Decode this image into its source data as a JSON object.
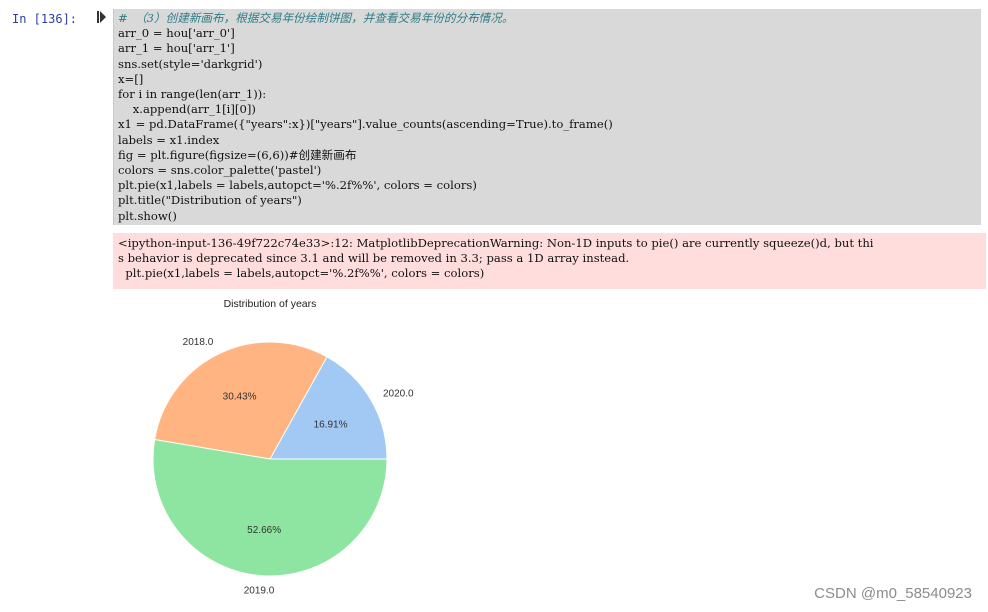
{
  "cell": {
    "prompt": "In  [136]:",
    "code_lines": [
      "#  （3）创建新画布，根据交易年份绘制饼图，并查看交易年份的分布情况。",
      "arr_0 = hou['arr_0']",
      "arr_1 = hou['arr_1']",
      "sns.set(style='darkgrid')",
      "x=[]",
      "for i in range(len(arr_1)):",
      "    x.append(arr_1[i][0])",
      "x1 = pd.DataFrame({\"years\":x})[\"years\"].value_counts(ascending=True).to_frame()",
      "labels = x1.index",
      "fig = plt.figure(figsize=(6,6))#创建新画布",
      "colors = sns.color_palette('pastel')",
      "plt.pie(x1,labels = labels,autopct='%.2f%%', colors = colors)",
      "plt.title(\"Distribution of years\")",
      "plt.show()"
    ],
    "warning_lines": [
      "<ipython-input-136-49f722c74e33>:12: MatplotlibDeprecationWarning: Non-1D inputs to pie() are currently squeeze()d, but thi",
      "s behavior is deprecated since 3.1 and will be removed in 3.3; pass a 1D array instead.",
      "  plt.pie(x1,labels = labels,autopct='%.2f%%', colors = colors)"
    ]
  },
  "colors": {
    "slice_2020": "#a1c9f4",
    "slice_2018": "#ffb482",
    "slice_2019": "#8de5a1",
    "code_bg": "#d9d9d9",
    "warning_bg": "#ffdddd"
  },
  "chart_data": {
    "type": "pie",
    "title": "Distribution of years",
    "categories": [
      "2020.0",
      "2018.0",
      "2019.0"
    ],
    "values": [
      16.91,
      30.43,
      52.66
    ],
    "autopct_labels": [
      "16.91%",
      "30.43%",
      "52.66%"
    ],
    "start_angle_deg": 0,
    "direction": "counterclockwise"
  },
  "watermark": "CSDN @m0_58540923"
}
